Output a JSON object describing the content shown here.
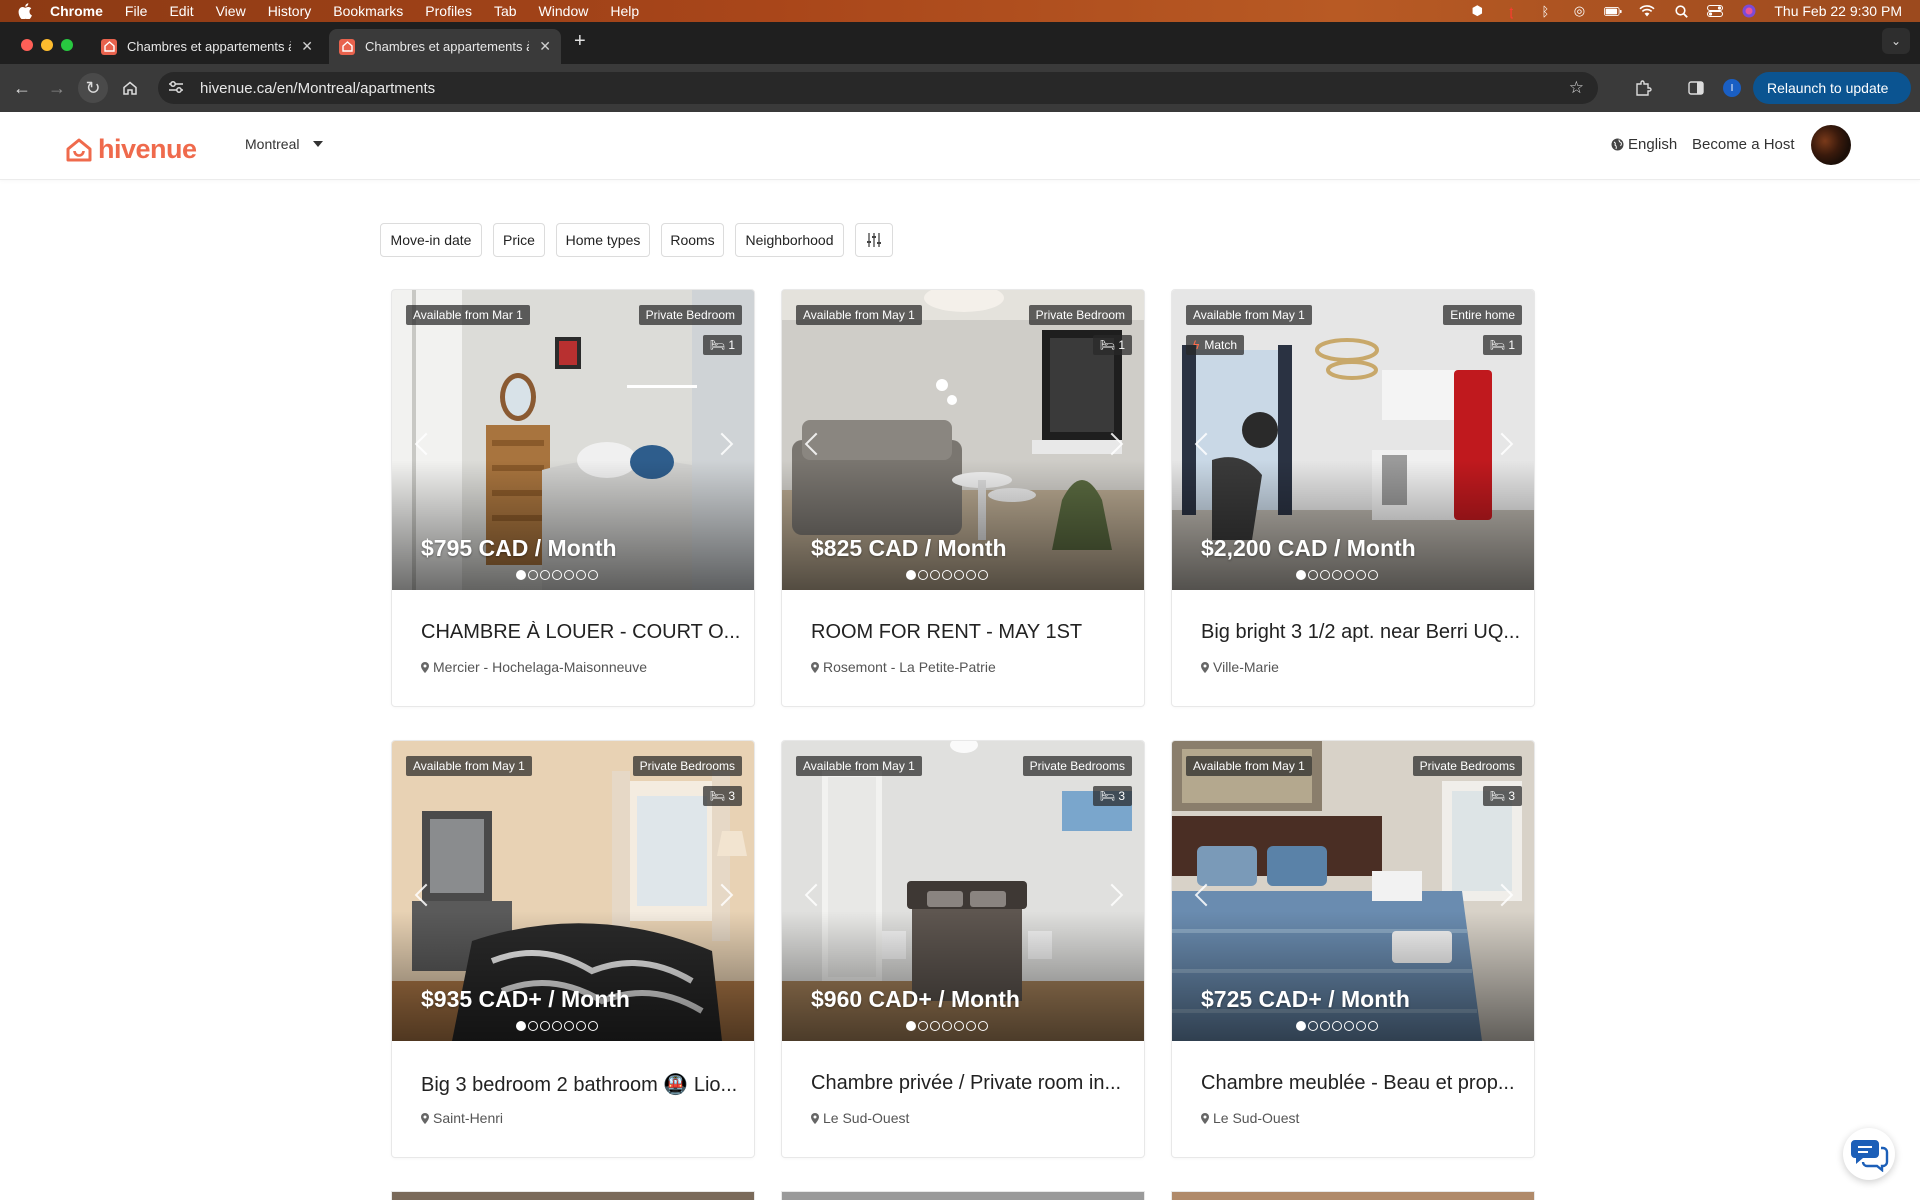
{
  "menubar": {
    "app": "Chrome",
    "items": [
      "File",
      "Edit",
      "View",
      "History",
      "Bookmarks",
      "Profiles",
      "Tab",
      "Window",
      "Help"
    ],
    "datetime": "Thu Feb 22  9:30 PM"
  },
  "browser": {
    "tabs": [
      {
        "title": "Chambres et appartements à"
      },
      {
        "title": "Chambres et appartements à"
      }
    ],
    "url": "hivenue.ca/en/Montreal/apartments",
    "relaunch_label": "Relaunch to update",
    "profile_initial": "I"
  },
  "site": {
    "logo": "hivenue",
    "city": "Montreal",
    "language": "English",
    "become_host": "Become a Host"
  },
  "filters": [
    "Move-in date",
    "Price",
    "Home types",
    "Rooms",
    "Neighborhood"
  ],
  "listings": [
    {
      "available": "Available from Mar 1",
      "type": "Private Bedroom",
      "beds": "1",
      "match": "",
      "price": "$795 CAD / Month",
      "title": "CHAMBRE À LOUER - COURT O...",
      "location": "Mercier - Hochelaga-Maisonneuve"
    },
    {
      "available": "Available from May 1",
      "type": "Private Bedroom",
      "beds": "1",
      "match": "",
      "price": "$825 CAD / Month",
      "title": "ROOM FOR RENT - MAY 1ST",
      "location": "Rosemont - La Petite-Patrie"
    },
    {
      "available": "Available from May 1",
      "type": "Entire home",
      "beds": "1",
      "match": "Match",
      "price": "$2,200 CAD / Month",
      "title": "Big bright 3 1/2 apt. near Berri UQ...",
      "location": "Ville-Marie"
    },
    {
      "available": "Available from May 1",
      "type": "Private Bedrooms",
      "beds": "3",
      "match": "",
      "price": "$935 CAD+ / Month",
      "title": "Big 3 bedroom 2 bathroom 🚇 Lio...",
      "location": "Saint-Henri"
    },
    {
      "available": "Available from May 1",
      "type": "Private Bedrooms",
      "beds": "3",
      "match": "",
      "price": "$960 CAD+ / Month",
      "title": "Chambre privée / Private room in...",
      "location": "Le Sud-Ouest"
    },
    {
      "available": "Available from May 1",
      "type": "Private Bedrooms",
      "beds": "3",
      "match": "",
      "price": "$725 CAD+ / Month",
      "title": "Chambre meublée - Beau et prop...",
      "location": "Le Sud-Ouest"
    }
  ],
  "colors": {
    "brand": "#ef6a4c",
    "relaunch": "#0b5491"
  }
}
